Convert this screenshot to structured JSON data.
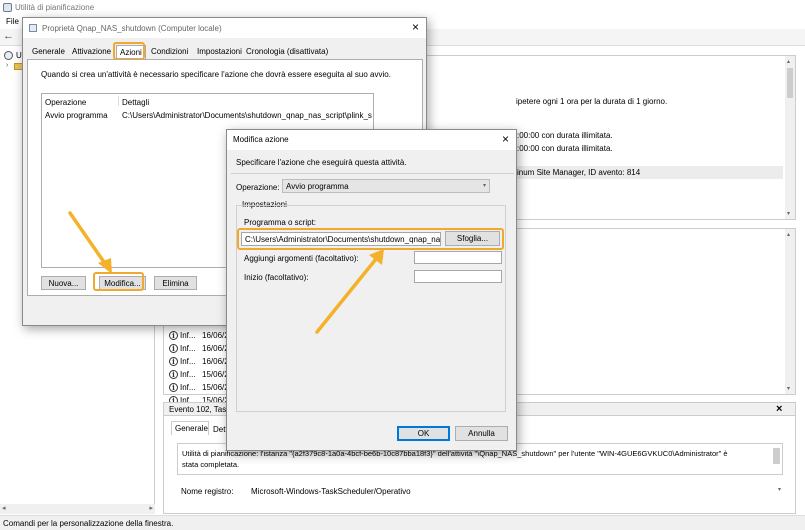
{
  "app": {
    "title": "Utilità di pianificazione",
    "menu_file": "File",
    "status_bar": "Comandi per la personalizzazione della finestra."
  },
  "background": {
    "lines": [
      "ipetere ogni 1 ora per la durata di 1 giorno.",
      ":00:00 con durata illimitata.",
      ":00:00 con durata illimitata.",
      "inum Site Manager, ID avento: 814"
    ],
    "tree_item": "U",
    "log_rows": [
      {
        "level": "Inf...",
        "date": "16/06/2"
      },
      {
        "level": "Inf...",
        "date": "16/06/2"
      },
      {
        "level": "Inf...",
        "date": "16/06/2"
      },
      {
        "level": "Inf...",
        "date": "15/06/2"
      },
      {
        "level": "Inf...",
        "date": "15/06/2"
      },
      {
        "level": "Inf...",
        "date": "15/06/2"
      }
    ],
    "event_header": "Evento 102, Task",
    "event_close": "×",
    "event_tab_general": "Generale",
    "event_tab_details": "Dett",
    "event_message_1": "Utilità di pianificazione: l'istanza \"{a2f379c8-1a0a-4bcf-be6b-10c87bba18f3}\" dell'attività \"\\Qnap_NAS_shutdown\" per l'utente \"WIN-4GUE6GVKUC0\\Administrator\" è",
    "event_message_2": "stata completata.",
    "registry_label": "Nome registro:",
    "registry_value": "Microsoft-Windows-TaskScheduler/Operativo"
  },
  "props_dialog": {
    "title": "Proprietà Qnap_NAS_shutdown (Computer locale)",
    "close": "×",
    "tabs": [
      "Generale",
      "Attivazione",
      "Azioni",
      "Condizioni",
      "Impostazioni",
      "Cronologia (disattivata)"
    ],
    "active_tab": "Azioni",
    "description": "Quando si crea un'attività è necessario specificare l'azione che dovrà essere eseguita al suo avvio.",
    "table_headers": [
      "Operazione",
      "Dettagli"
    ],
    "rows": [
      {
        "operation": "Avvio programma",
        "details": "C:\\Users\\Administrator\\Documents\\shutdown_qnap_nas_script\\plink_shutd"
      }
    ],
    "buttons": {
      "new": "Nuova...",
      "edit": "Modifica...",
      "delete": "Elimina"
    }
  },
  "action_dialog": {
    "title": "Modifica azione",
    "close": "×",
    "instruction": "Specificare l'azione che eseguirà questa attività.",
    "operation_label": "Operazione:",
    "operation_value": "Avvio programma",
    "settings_label": "Impostazioni",
    "program_label": "Programma o script:",
    "program_value": "C:\\Users\\Administrator\\Documents\\shutdown_qnap_nas_s",
    "browse": "Sfoglia...",
    "args_label": "Aggiungi argomenti (facoltativo):",
    "args_value": "",
    "start_label": "Inizio (facoltativo):",
    "start_value": "",
    "ok": "OK",
    "cancel": "Annulla"
  },
  "colors": {
    "highlight": "#f0a830",
    "primary_border": "#0078d7"
  }
}
